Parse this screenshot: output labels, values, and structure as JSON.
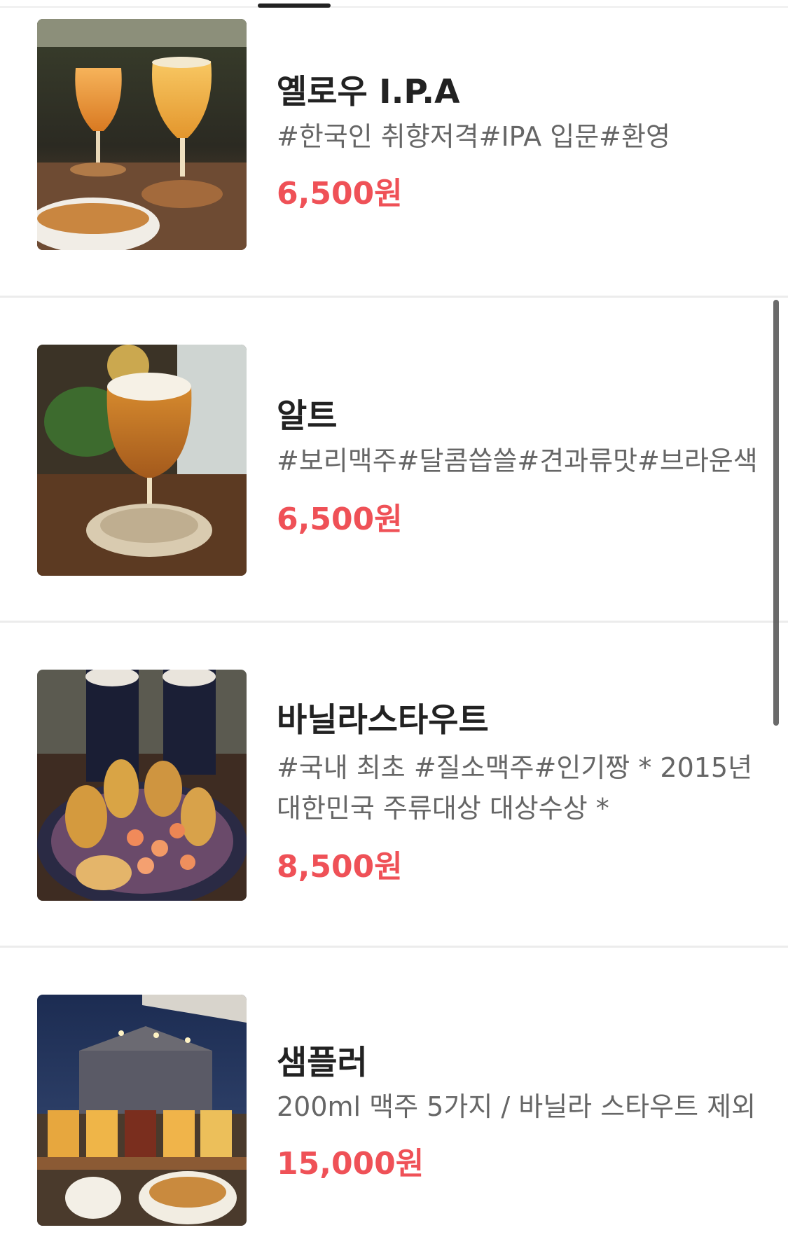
{
  "menu": {
    "items": [
      {
        "name": "옐로우 I.P.A",
        "tags": "#한국인 취향저격#IPA 입문#환영",
        "price": "6,500원",
        "image": "yellow-ipa-photo"
      },
      {
        "name": "알트",
        "tags": "#보리맥주#달콤씁쓸#견과류맛#브라운색",
        "price": "6,500원",
        "image": "alt-beer-photo"
      },
      {
        "name": "바닐라스타우트",
        "tags": "#국내 최초 #질소맥주#인기짱 * 2015년 대한민국 주류대상 대상수상 *",
        "price": "8,500원",
        "image": "vanilla-stout-photo"
      },
      {
        "name": "샘플러",
        "tags": "200ml 맥주 5가지 / 바닐라 스타우트 제외",
        "price": "15,000원",
        "image": "sampler-photo"
      }
    ]
  },
  "colors": {
    "price": "#ef5157",
    "name": "#222222",
    "tags": "#666666",
    "divider": "#ececec"
  }
}
